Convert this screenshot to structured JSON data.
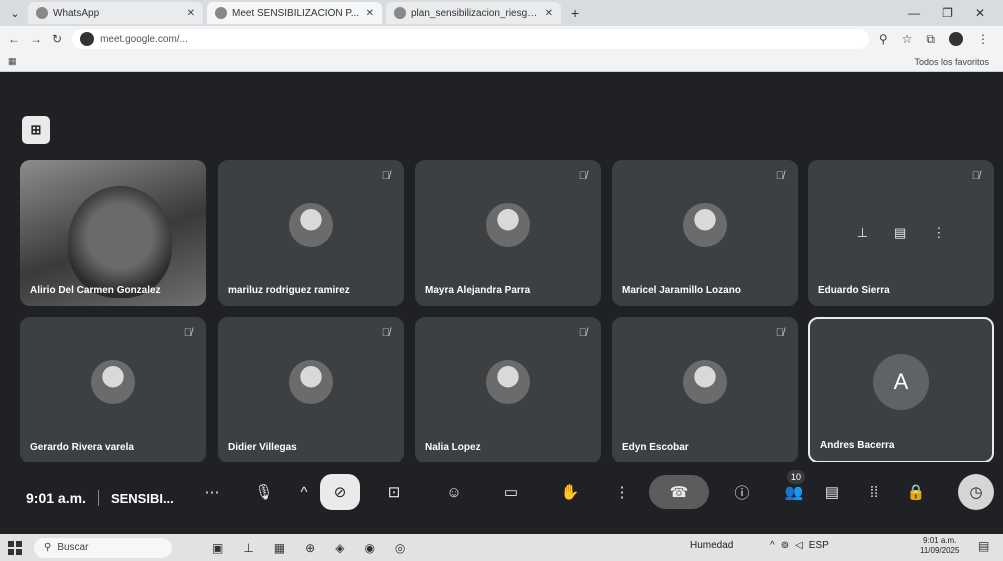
{
  "browser": {
    "tabs": [
      {
        "label": "WhatsApp",
        "active": false
      },
      {
        "label": "Meet SENSIBILIZACIÓN P...",
        "active": true
      },
      {
        "label": "plan_sensibilizacion_riesgos...",
        "active": false
      }
    ],
    "new_tab": "+",
    "url": "meet.google.com/...",
    "bookmarks_right": "Todos los favoritos"
  },
  "meet": {
    "participants": [
      {
        "name": "Alirio Del Carmen Gonzalez",
        "muted": false,
        "video": true
      },
      {
        "name": "mariluz rodriguez ramirez",
        "muted": true
      },
      {
        "name": "Mayra Alejandra Parra",
        "muted": true
      },
      {
        "name": "Maricel Jaramillo Lozano",
        "muted": true
      },
      {
        "name": "Eduardo Sierra",
        "muted": true
      },
      {
        "name": "Gerardo Rivera varela",
        "muted": true
      },
      {
        "name": "Didier Villegas",
        "muted": true
      },
      {
        "name": "Nalia Lopez",
        "muted": true
      },
      {
        "name": "Edyn Escobar",
        "muted": true
      },
      {
        "name": "Andres Bacerra",
        "muted": false,
        "initial": "A",
        "selected": true
      }
    ],
    "controls": {
      "time": "9:01 a.m.",
      "meeting_name": "SENSIBI...",
      "participant_count": "10"
    }
  },
  "taskbar": {
    "search_placeholder": "Buscar",
    "weather": "Humedad",
    "language": "ESP",
    "time": "9:01 a.m.",
    "date": "11/09/2025"
  },
  "colors": {
    "meet_bg": "#202124",
    "tile_bg": "#3c4043",
    "end_call": "#5c5c5c"
  }
}
